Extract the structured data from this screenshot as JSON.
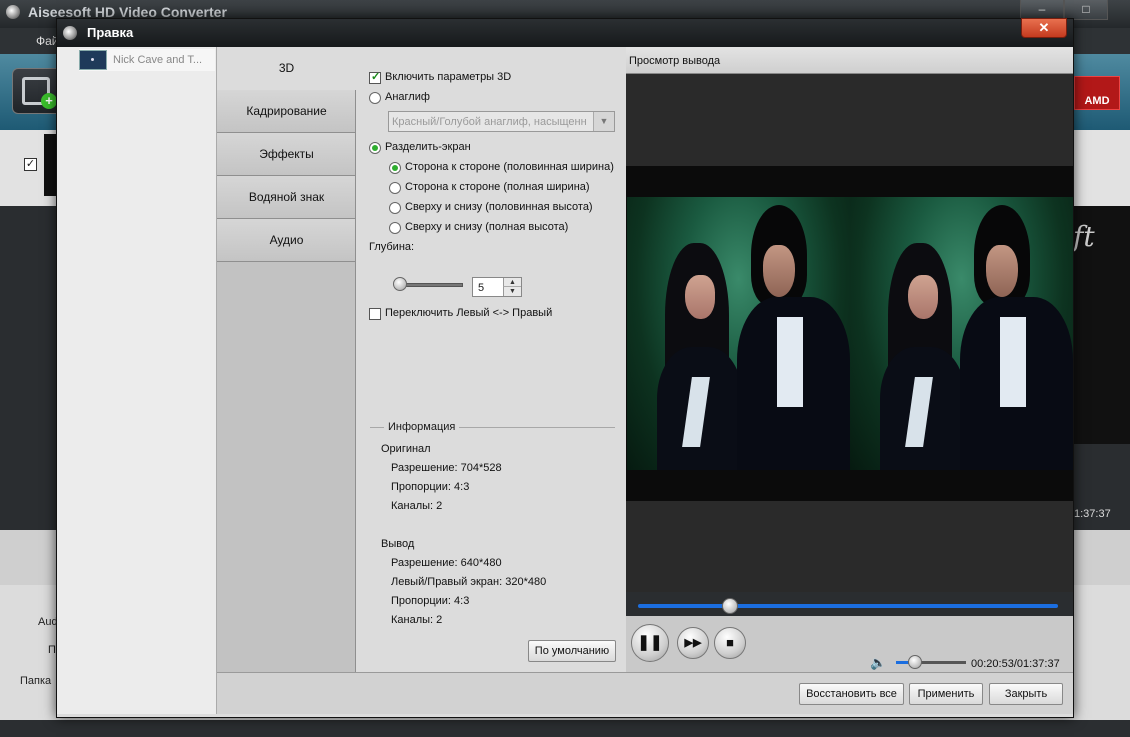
{
  "main_app": {
    "title": "Aiseesoft HD Video Converter",
    "menu_first": "Фай",
    "amd_badge": "AMD",
    "time_display": "1:37:37",
    "strip_text": "ft",
    "lower_labels": [
      "Aud",
      "П",
      "Папка"
    ]
  },
  "dialog": {
    "title": "Правка",
    "close_label": "✕",
    "file_list": [
      {
        "name": "Nick Cave and T..."
      }
    ],
    "tabs": [
      "3D",
      "Кадрирование",
      "Эффекты",
      "Водяной знак",
      "Аудио"
    ],
    "active_tab": "3D",
    "settings_3d": {
      "enable_label": "Включить параметры 3D",
      "enable_checked": true,
      "anaglyph_label": "Анаглиф",
      "anaglyph_selected": false,
      "anaglyph_option": "Красный/Голубой анаглиф, насыщенн",
      "split_label": "Разделить-экран",
      "split_selected": true,
      "split_options": [
        {
          "label": "Сторона к стороне (половинная ширина)",
          "selected": true
        },
        {
          "label": "Сторона к стороне (полная ширина)",
          "selected": false
        },
        {
          "label": "Сверху и снизу (половинная высота)",
          "selected": false
        },
        {
          "label": "Сверху и снизу (полная высота)",
          "selected": false
        }
      ],
      "depth_label": "Глубина:",
      "depth_value": "5",
      "depth_level": 0.0,
      "swap_label": "Переключить Левый <-> Правый",
      "swap_checked": false
    },
    "info": {
      "title": "Информация",
      "original_label": "Оригинал",
      "original": [
        "Разрешение: 704*528",
        "Пропорции: 4:3",
        "Каналы: 2"
      ],
      "output_label": "Вывод",
      "output": [
        "Разрешение: 640*480",
        "Левый/Правый экран: 320*480",
        "Пропорции: 4:3",
        "Каналы: 2"
      ]
    },
    "default_button": "По умолчанию",
    "preview": {
      "title": "Просмотр вывода",
      "timecode": "00:20:53/01:37:37",
      "seek_fraction": 0.21,
      "volume_fraction": 0.28
    },
    "footer_buttons": {
      "restore_all": "Восстановить все",
      "apply": "Применить",
      "close": "Закрыть"
    }
  }
}
